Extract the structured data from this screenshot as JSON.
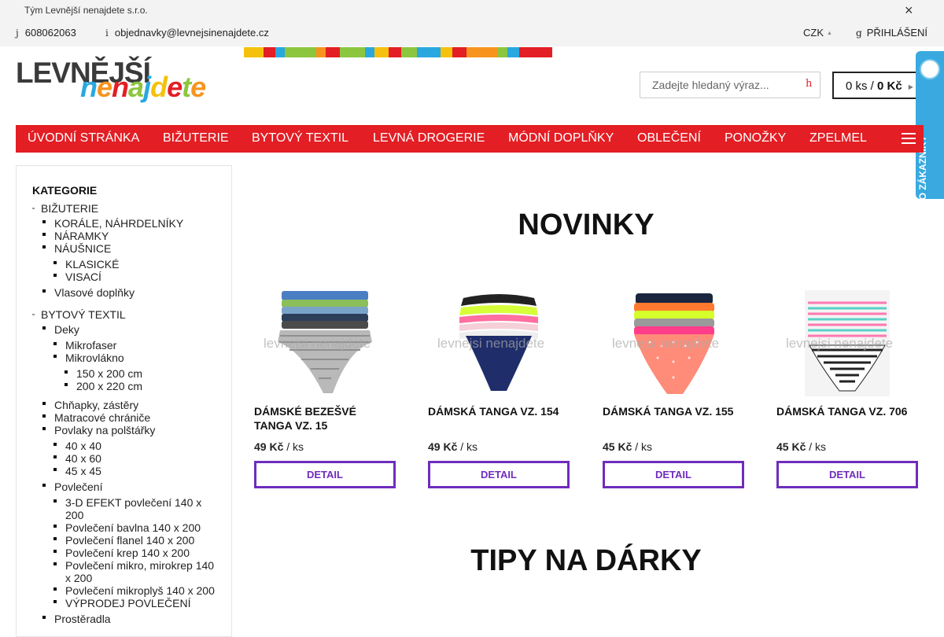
{
  "topbar": {
    "company": "Tým Levnější nenajdete s.r.o.",
    "phone_icon": "j",
    "phone": "608062063",
    "email_icon": "i",
    "email": "objednavky@levnejsinenajdete.cz",
    "currency": "CZK",
    "login_icon": "g",
    "login": "PŘIHLÁŠENÍ",
    "close_icon": "×"
  },
  "logo": {
    "line1": "LEVNĚJŠÍ",
    "line2": "nenajdete"
  },
  "search": {
    "placeholder": "Zadejte hledaný výraz...",
    "button_icon": "h"
  },
  "cart": {
    "count": "0 ks",
    "separator": " / ",
    "total": "0 Kč"
  },
  "badge": {
    "label": "OVĚŘENO ZÁKAZNÍKY"
  },
  "nav": {
    "items": [
      "ÚVODNÍ STRÁNKA",
      "BIŽUTERIE",
      "BYTOVÝ TEXTIL",
      "LEVNÁ DROGERIE",
      "MÓDNÍ DOPLŇKY",
      "OBLEČENÍ",
      "PONOŽKY",
      "ZPELMEL"
    ]
  },
  "sidebar": {
    "title": "KATEGORIE",
    "items": [
      "BIŽUTERIE",
      "KORÁLE, NÁHRDELNÍKY",
      "NÁRAMKY",
      "NÁUŠNICE",
      "KLASICKÉ",
      "VISACÍ",
      "Vlasové doplňky",
      "BYTOVÝ TEXTIL",
      "Deky",
      "Mikrofaser",
      "Mikrovlákno",
      "150 x 200 cm",
      "200 x 220 cm",
      "Chňapky, zástěry",
      "Matracové chrániče",
      "Povlaky na polštářky",
      "40 x 40",
      "40 x 60",
      "45 x 45",
      "Povlečení",
      "3-D EFEKT povlečení 140 x 200",
      "Povlečení bavlna 140 x 200",
      "Povlečení flanel 140 x 200",
      "Povlečení krep 140 x 200",
      "Povlečení mikro, mirokrep 140 x 200",
      "Povlečení mikroplyš 140 x 200",
      "VÝPRODEJ POVLEČENÍ",
      "Prostěradla"
    ]
  },
  "sections": {
    "new": "NOVINKY",
    "gifts": "TIPY NA DÁRKY"
  },
  "watermark": "levnejsi nenajdete",
  "products": [
    {
      "name": "DÁMSKÉ BEZEŠVÉ TANGA VZ. 15",
      "price": "49 Kč",
      "unit": " / ks",
      "button": "DETAIL"
    },
    {
      "name": "DÁMSKÁ TANGA VZ. 154",
      "price": "49 Kč",
      "unit": " / ks",
      "button": "DETAIL"
    },
    {
      "name": "DÁMSKÁ TANGA VZ. 155",
      "price": "45 Kč",
      "unit": " / ks",
      "button": "DETAIL"
    },
    {
      "name": "DÁMSKÁ TANGA VZ. 706",
      "price": "45 Kč",
      "unit": " / ks",
      "button": "DETAIL"
    }
  ],
  "colors": {
    "brand_red": "#e31e24",
    "detail_purple": "#6f2dbd",
    "badge_blue": "#39a9e0",
    "stripe": [
      "#f4c20d",
      "#e31e24",
      "#29a8e0",
      "#8cc63f",
      "#f7941d",
      "#e31e24",
      "#8cc63f",
      "#29a8e0",
      "#f4c20d",
      "#e31e24",
      "#8cc63f",
      "#29a8e0",
      "#f4c20d",
      "#e31e24",
      "#f7941d",
      "#8cc63f",
      "#29a8e0",
      "#e31e24"
    ]
  }
}
